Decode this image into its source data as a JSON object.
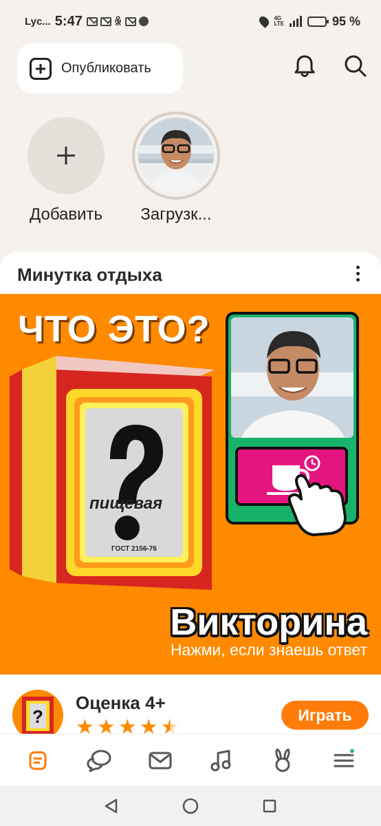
{
  "status_bar": {
    "carrier": "Lyc...",
    "time": "5:47",
    "network": "4G LTE",
    "battery": "95 %"
  },
  "top_bar": {
    "publish_label": "Опубликовать",
    "icons": [
      "plus-square-icon",
      "bell-icon",
      "search-icon"
    ]
  },
  "stories": [
    {
      "label": "Добавить",
      "type": "add"
    },
    {
      "label": "Загрузк...",
      "type": "avatar"
    }
  ],
  "card": {
    "title": "Минутка отдыха",
    "banner": {
      "question": "ЧТО ЭТО?",
      "box_text": "пищевая",
      "box_gost": "ГОСТ 2156-76",
      "quiz_title": "Викторина",
      "quiz_subtitle": "Нажми, если знаешь ответ"
    },
    "game": {
      "rating_label": "Оценка 4+",
      "stars": 4.5,
      "play_label": "Играть"
    }
  },
  "colors": {
    "accent": "#ff8a00",
    "button": "#ff7c0a",
    "notification_dot": "#1fbf6a",
    "pink": "#e5157f",
    "green": "#18b36b"
  },
  "bottom_nav": [
    {
      "name": "feed",
      "icon": "feed-icon",
      "active": true
    },
    {
      "name": "discussions",
      "icon": "chat-bubbles-icon",
      "active": false
    },
    {
      "name": "messages",
      "icon": "mail-icon",
      "active": false
    },
    {
      "name": "music",
      "icon": "music-note-icon",
      "active": false
    },
    {
      "name": "games",
      "icon": "bunny-icon",
      "active": false
    },
    {
      "name": "menu",
      "icon": "menu-icon",
      "active": false,
      "badge": true
    }
  ],
  "system_nav": [
    "back-icon",
    "home-icon",
    "recents-icon"
  ]
}
